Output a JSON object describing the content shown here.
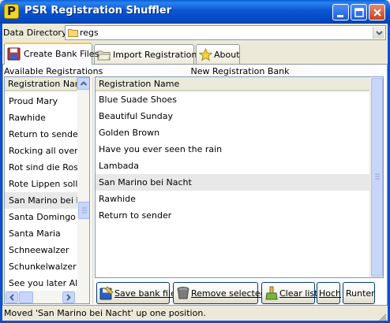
{
  "window": {
    "title": "PSR Registration Shuffler",
    "app_icon_letter": "P",
    "title_color": "#0a5fd6"
  },
  "data_directory": {
    "label": "Data Directory:",
    "value": "regs"
  },
  "tabs": [
    {
      "label": "Create Bank Files",
      "icon": "floppy-disk-icon",
      "active": true
    },
    {
      "label": "Import Registrations",
      "icon": "folder-icon",
      "active": false
    },
    {
      "label": "About",
      "icon": "star-icon",
      "active": false
    }
  ],
  "available": {
    "title": "Available Registrations",
    "column_header": "Registration Name",
    "items": [
      "Proud Mary",
      "Rawhide",
      "Return to sender",
      "Rocking all over the world",
      "Rot sind die Rosen",
      "Rote Lippen soll man küssen",
      "San Marino bei Nacht",
      "Santa Domingo",
      "Santa Maria",
      "Schneewalzer",
      "Schunkelwalzer Medley",
      "See you later Alligator"
    ],
    "selected_index": 6
  },
  "bank": {
    "title": "New Registration Bank",
    "column_header": "Registration Name",
    "items": [
      "Blue Suade Shoes",
      "Beautiful Sunday",
      "Golden Brown",
      "Have you ever seen the rain",
      "Lambada",
      "San Marino bei Nacht",
      "Rawhide",
      "Return to sender"
    ],
    "selected_index": 5
  },
  "buttons": {
    "save": "Save bank file",
    "remove": "Remove selected",
    "clear": "Clear list",
    "up": "Hoch",
    "down": "Runter"
  },
  "status": {
    "message": "Moved 'San Marino bei Nacht' up one position."
  }
}
